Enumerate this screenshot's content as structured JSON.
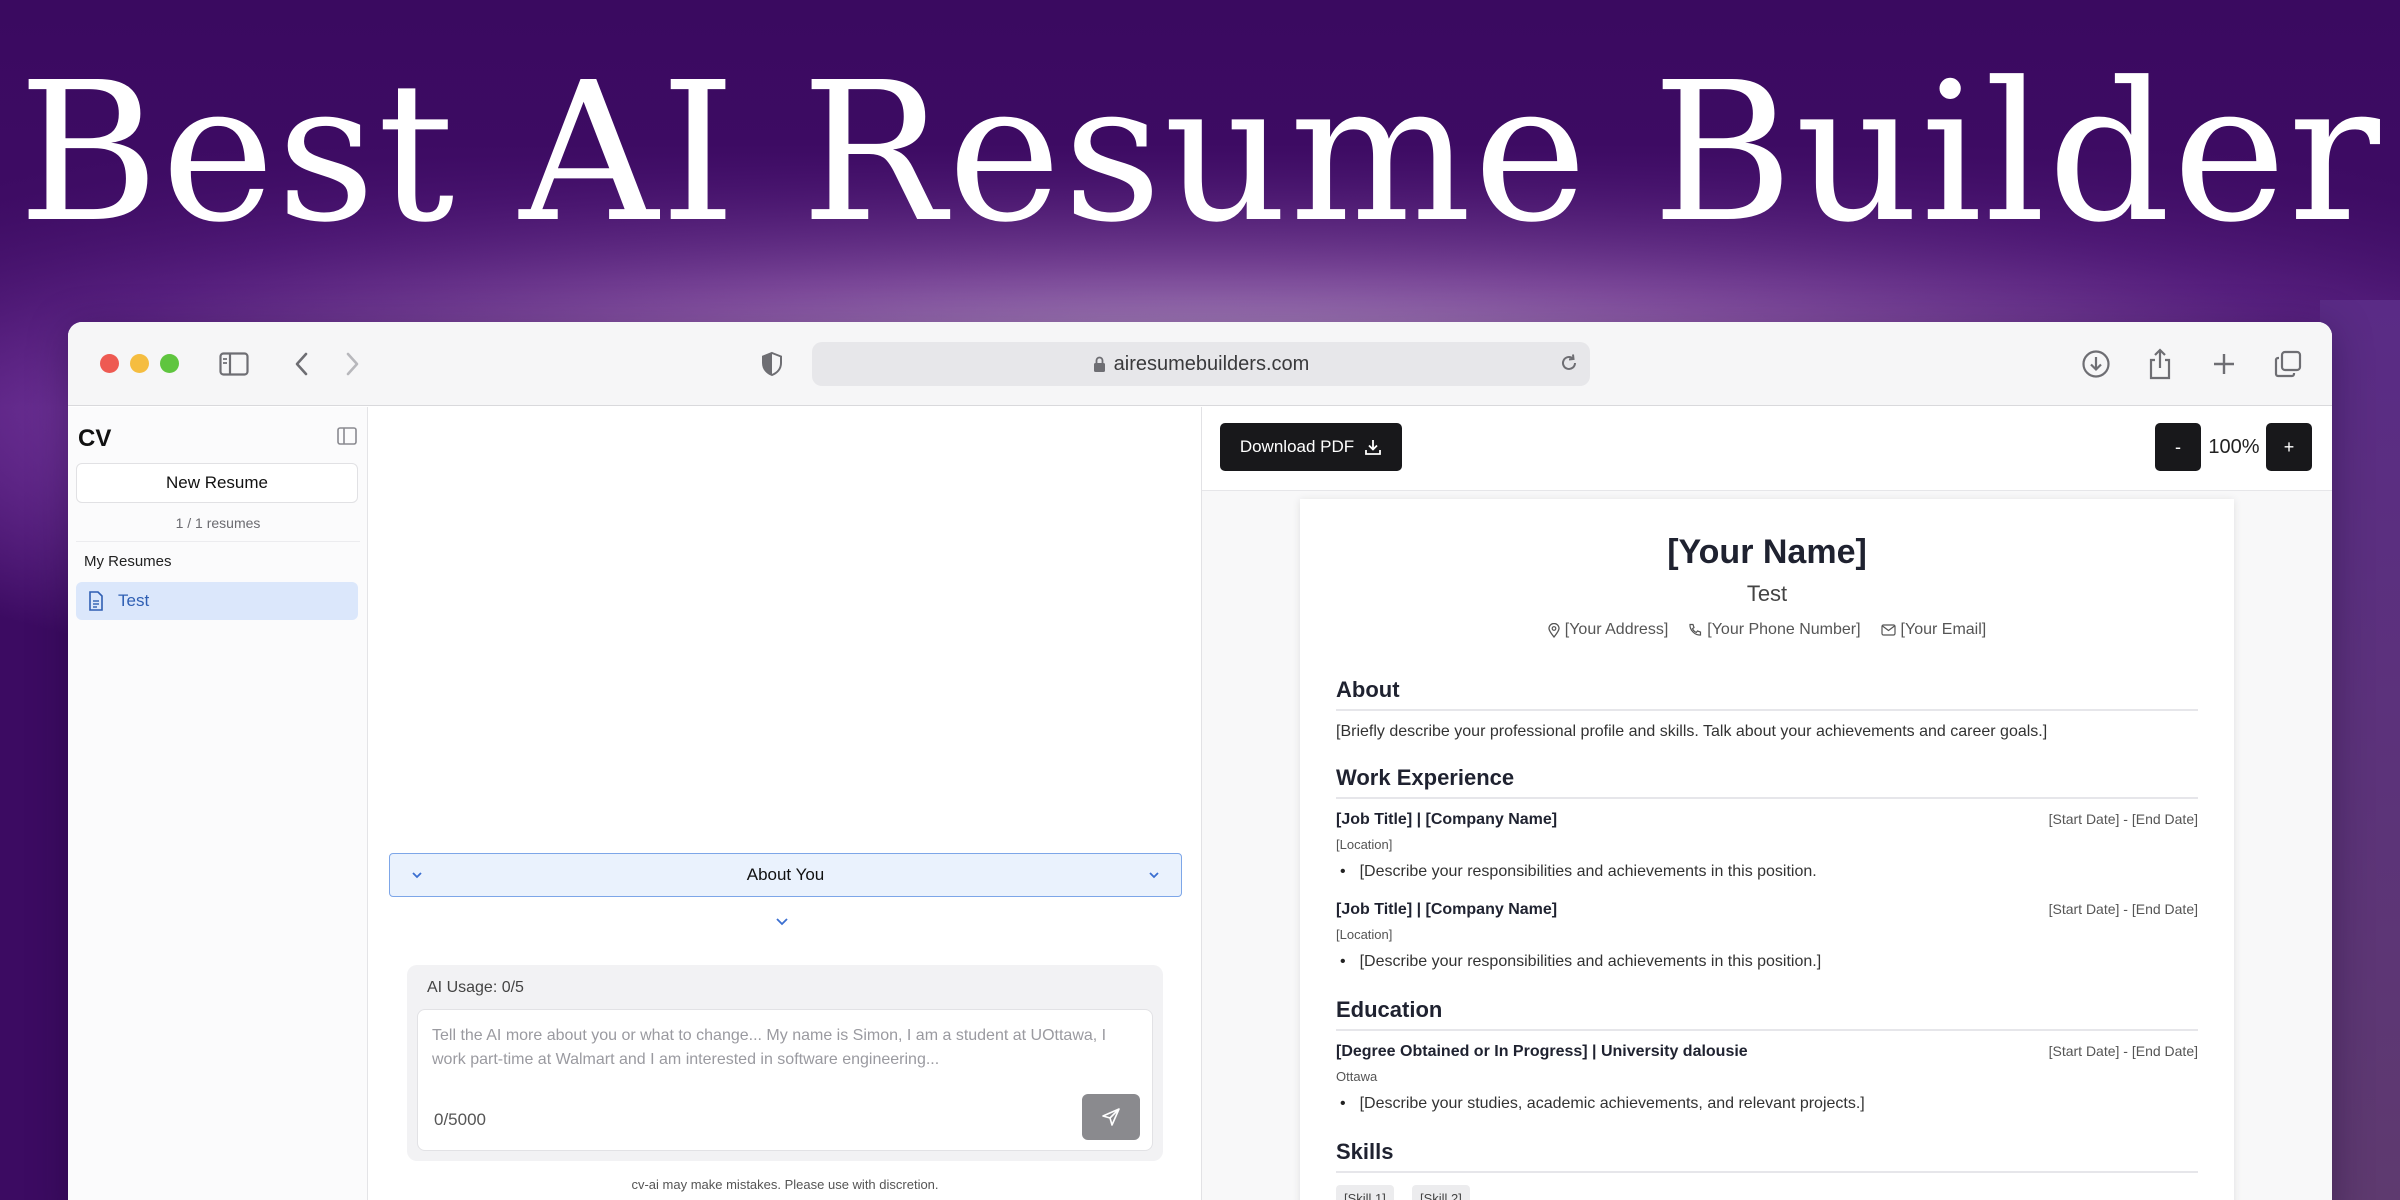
{
  "headline": "Best AI Resume Builder",
  "browser": {
    "url": "airesumebuilders.com"
  },
  "sidebar": {
    "logo": "CV",
    "new_resume_label": "New Resume",
    "resume_count": "1 / 1 resumes",
    "section_label": "My Resumes",
    "items": [
      {
        "label": "Test",
        "selected": true
      }
    ]
  },
  "chat": {
    "section_toggle_label": "About You",
    "ai_usage": "AI Usage: 0/5",
    "input_placeholder": "Tell the AI more about you or what to change... My name is Simon, I am a student at UOttawa, I work part-time at Walmart and I am interested in software engineering...",
    "char_counter": "0/5000",
    "disclaimer": "cv-ai may make mistakes. Please use with discretion."
  },
  "preview": {
    "download_label": "Download PDF",
    "zoom_minus": "-",
    "zoom_level": "100%",
    "zoom_plus": "+"
  },
  "resume": {
    "name": "[Your Name]",
    "title": "Test",
    "contact": {
      "address": "[Your Address]",
      "phone": "[Your Phone Number]",
      "email": "[Your Email]"
    },
    "about": {
      "heading": "About",
      "text": "[Briefly describe your professional profile and skills. Talk about your achievements and career goals.]"
    },
    "work": {
      "heading": "Work Experience",
      "entries": [
        {
          "title": "[Job Title] | [Company Name]",
          "dates": "[Start Date] - [End Date]",
          "location": "[Location]",
          "bullet": "[Describe your responsibilities and achievements in this position."
        },
        {
          "title": "[Job Title] | [Company Name]",
          "dates": "[Start Date] - [End Date]",
          "location": "[Location]",
          "bullet": "[Describe your responsibilities and achievements in this position.]"
        }
      ]
    },
    "education": {
      "heading": "Education",
      "entries": [
        {
          "title": "[Degree Obtained or In Progress] | University dalousie",
          "dates": "[Start Date] - [End Date]",
          "location": "Ottawa",
          "bullet": "[Describe your studies, academic achievements, and relevant projects.]"
        }
      ]
    },
    "skills": {
      "heading": "Skills",
      "items": [
        "[Skill 1]",
        "[Skill 2]"
      ]
    }
  }
}
